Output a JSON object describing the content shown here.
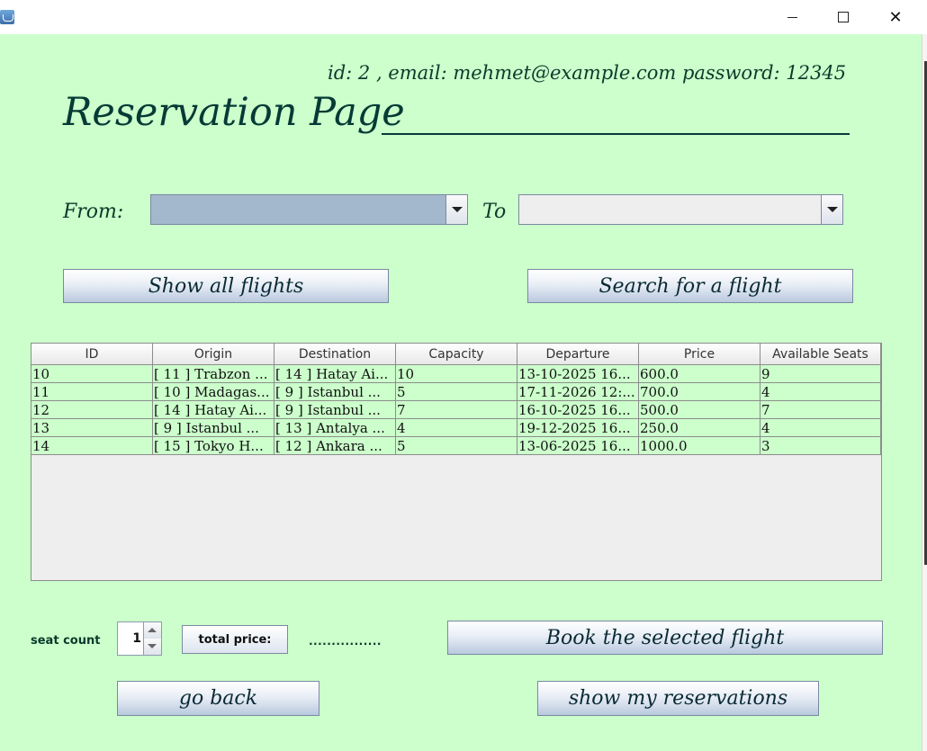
{
  "window": {
    "minimize_icon": "minimize-icon",
    "maximize_icon": "maximize-icon",
    "close_label": "✕"
  },
  "user_info": "id: 2 , email: mehmet@example.com password: 12345",
  "page_title": "Reservation Page",
  "from_label": "From:",
  "to_label": "To",
  "from_value": "",
  "to_value": "",
  "buttons": {
    "show_all": "Show all flights",
    "search": "Search for a flight",
    "book": "Book the selected flight",
    "go_back": "go back",
    "show_reservations": "show my reservations",
    "total_price": "total price:"
  },
  "table": {
    "columns": [
      "ID",
      "Origin",
      "Destination",
      "Capacity",
      "Departure",
      "Price",
      "Available Seats"
    ],
    "rows": [
      [
        "10",
        "[ 11 ] Trabzon ...",
        "[ 14 ] Hatay Ai...",
        "10",
        "13-10-2025 16...",
        "600.0",
        "9"
      ],
      [
        "11",
        "[ 10 ] Madagas...",
        "[ 9 ] Istanbul ...",
        "5",
        "17-11-2026 12:...",
        "700.0",
        "4"
      ],
      [
        "12",
        "[ 14 ] Hatay Ai...",
        "[ 9 ] Istanbul ...",
        "7",
        "16-10-2025 16...",
        "500.0",
        "7"
      ],
      [
        "13",
        "[ 9 ] Istanbul ...",
        "[ 13 ] Antalya ...",
        "4",
        "19-12-2025 16...",
        "250.0",
        "4"
      ],
      [
        "14",
        "[ 15 ] Tokyo H...",
        "[ 12 ] Ankara ...",
        "5",
        "13-06-2025 16...",
        "1000.0",
        "3"
      ]
    ]
  },
  "seat_count_label": "seat count",
  "seat_count_value": "1",
  "total_price_value": "................",
  "colors": {
    "background": "#ccffcc",
    "from_combo_bg": "#a3b8cc",
    "to_combo_bg": "#eeeeee"
  }
}
